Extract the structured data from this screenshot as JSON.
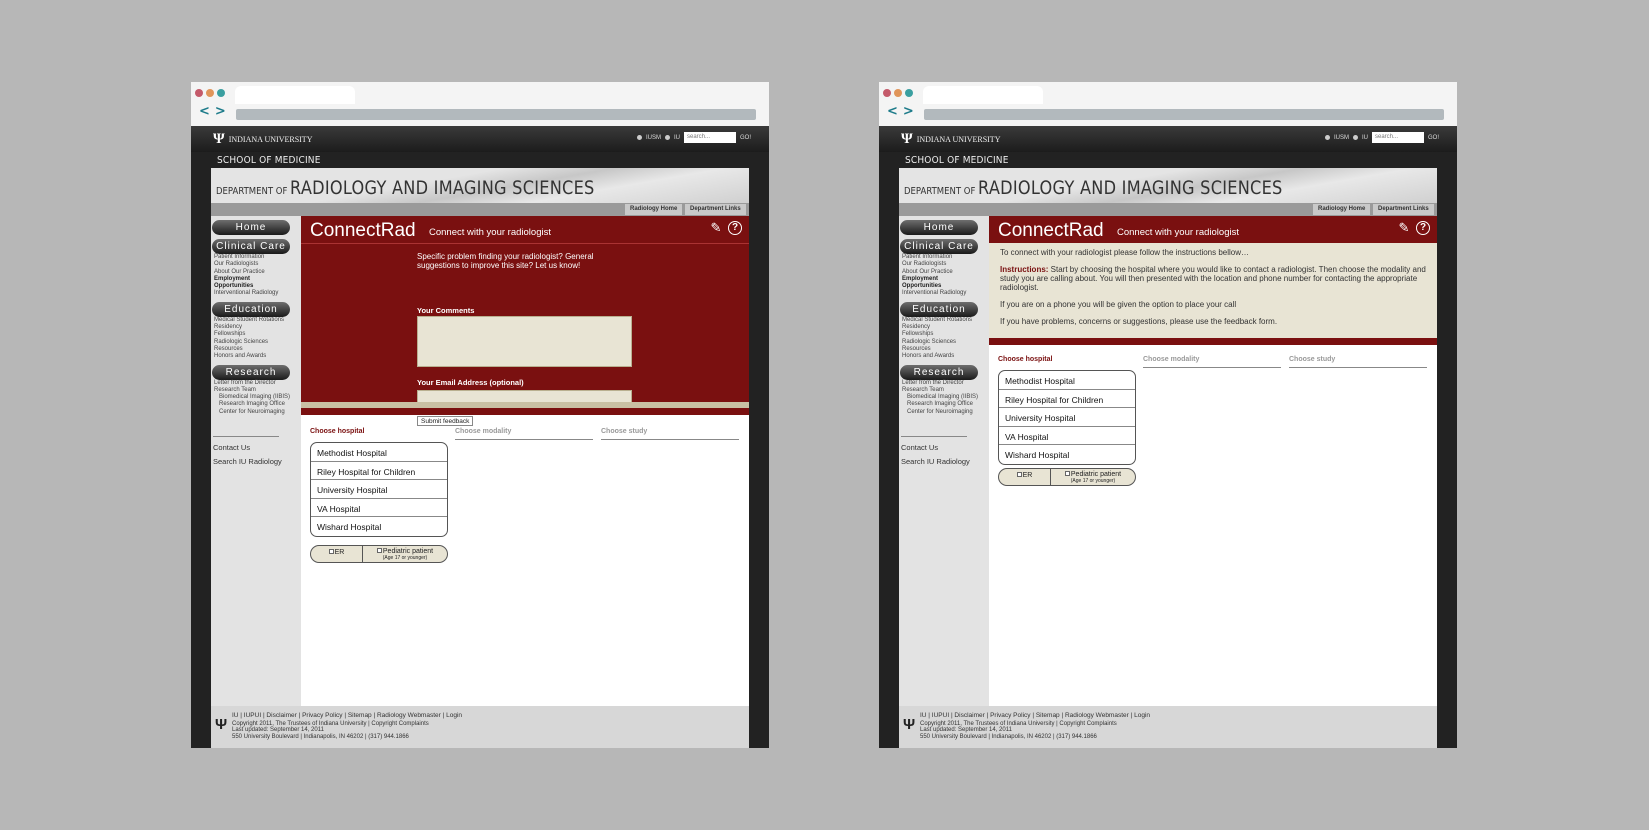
{
  "browser": {
    "dot_colors": [
      "#c45a6a",
      "#e0955a",
      "#3a9fa0"
    ],
    "nav_arrows": "<>"
  },
  "site": {
    "university": "INDIANA UNIVERSITY",
    "radio_options": [
      "IUSM",
      "IU"
    ],
    "search_placeholder": "search...",
    "go_label": "GO!",
    "school": "SCHOOL OF MEDICINE",
    "dept_prefix": "DEPARTMENT OF",
    "dept_name": "RADIOLOGY AND IMAGING SCIENCES",
    "links": [
      "Radiology Home",
      "Department Links"
    ]
  },
  "sidebar": {
    "home": "Home",
    "clinical": "Clinical Care",
    "clinical_items": [
      "Patient Information",
      "Our Radiologists",
      "About Our Practice",
      "Employment",
      "Opportunities",
      "Interventional Radiology"
    ],
    "education": "Education",
    "education_items": [
      "Medical Student Rotations",
      "Residency",
      "Fellowships",
      "Radiologic Sciences",
      "Resources",
      "Honors and Awards"
    ],
    "research": "Research",
    "research_items": [
      "Letter from the Director",
      "Research Team",
      "Biomedical Imaging (IIBIS)",
      "Research Imaging Office",
      "Center for Neuroimaging"
    ],
    "contact": "Contact Us",
    "search": "Search IU Radiology"
  },
  "connectrad": {
    "title": "ConnectRad",
    "subtitle": "Connect with your radiologist",
    "edit_icon": "edit-icon",
    "help_icon": "help-icon"
  },
  "feedback": {
    "intro": "Specific problem finding your radiologist? General suggestions to improve this site? Let us know!",
    "comments_label": "Your Comments",
    "email_label": "Your Email Address (optional)",
    "submit": "Submit feedback"
  },
  "instructions": {
    "line1": "To connect with your radiologist please follow the instructions bellow…",
    "label": "Instructions:",
    "text": " Start by choosing the hospital where you would like to contact a radiologist. Then choose the modality and study you are calling about. You will then presented with the location and phone number for contacting the appropriate radiologist.",
    "phone": "If you are on a phone you will be given the option to place your call",
    "problems": "If you have problems, concerns or suggestions, please use the feedback form."
  },
  "chooser": {
    "col_hospital": "Choose hospital",
    "col_modality": "Choose modality",
    "col_study": "Choose study",
    "hospitals": [
      "Methodist Hospital",
      "Riley Hospital for Children",
      "University Hospital",
      "VA Hospital",
      "Wishard Hospital"
    ],
    "er": "ER",
    "pediatric": "Pediatric patient",
    "pediatric_note": "(Age 17 or younger)"
  },
  "footer": {
    "links": "IU | IUPUI | Disclaimer | Privacy Policy | Sitemap | Radiology Webmaster | Login",
    "copyright": "Copyright 2011, The Trustees of Indiana University | Copyright Complaints",
    "updated": "Last updated: September 14, 2011",
    "address": "550 University Boulevard | Indianapolis, IN 46202 | (317) 944.1866"
  }
}
